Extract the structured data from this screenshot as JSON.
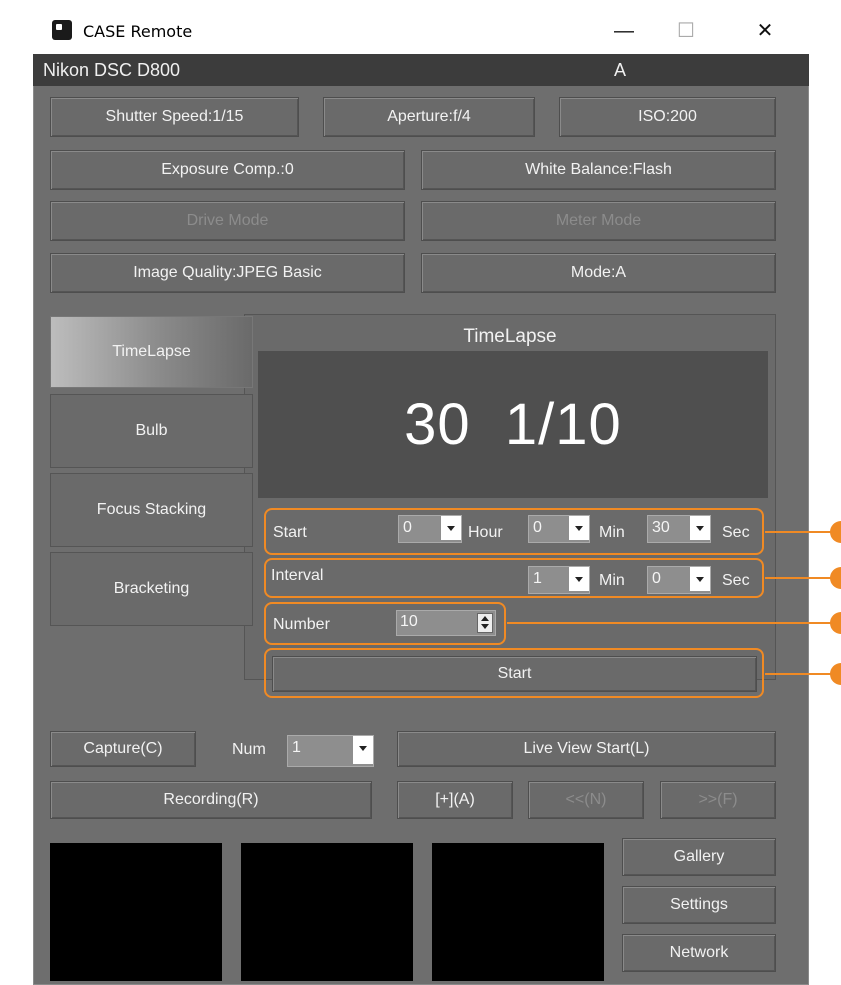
{
  "window": {
    "title": "CASE Remote",
    "controls": {
      "minimize": "—",
      "maximize": "☐",
      "close": "✕"
    }
  },
  "device": {
    "name": "Nikon DSC D800",
    "mode": "A"
  },
  "settings": {
    "shutter_speed": "Shutter Speed:1/15",
    "aperture": "Aperture:f/4",
    "iso": "ISO:200",
    "exposure_comp": "Exposure Comp.:0",
    "white_balance": "White Balance:Flash",
    "drive_mode": "Drive Mode",
    "meter_mode": "Meter Mode",
    "image_quality": "Image Quality:JPEG Basic",
    "mode": "Mode:A"
  },
  "tabs": [
    {
      "label": "TimeLapse",
      "active": true
    },
    {
      "label": "Bulb",
      "active": false
    },
    {
      "label": "Focus Stacking",
      "active": false
    },
    {
      "label": "Bracketing",
      "active": false
    }
  ],
  "timelapse": {
    "heading": "TimeLapse",
    "display": "30  1/10",
    "start_label": "Start",
    "start_hour": "0",
    "hour_label": "Hour",
    "start_min": "0",
    "min_label": "Min",
    "start_sec": "30",
    "sec_label": "Sec",
    "interval_label": "Interval",
    "interval_min": "1",
    "interval_sec": "0",
    "number_label": "Number",
    "number_value": "10",
    "start_button": "Start"
  },
  "capture": {
    "capture_button": "Capture(C)",
    "num_label": "Num",
    "num_value": "1",
    "live_view_button": "Live View Start(L)",
    "recording_button": "Recording(R)",
    "af_button": "[+](A)",
    "near_button": "<<(N)",
    "far_button": ">>(F)"
  },
  "side_buttons": {
    "gallery": "Gallery",
    "settings": "Settings",
    "network": "Network"
  },
  "colors": {
    "accent": "#f08a24",
    "window_bg": "#6e6e6e",
    "device_bar": "#3c3c3c",
    "display_bg": "#4f4f4f"
  }
}
